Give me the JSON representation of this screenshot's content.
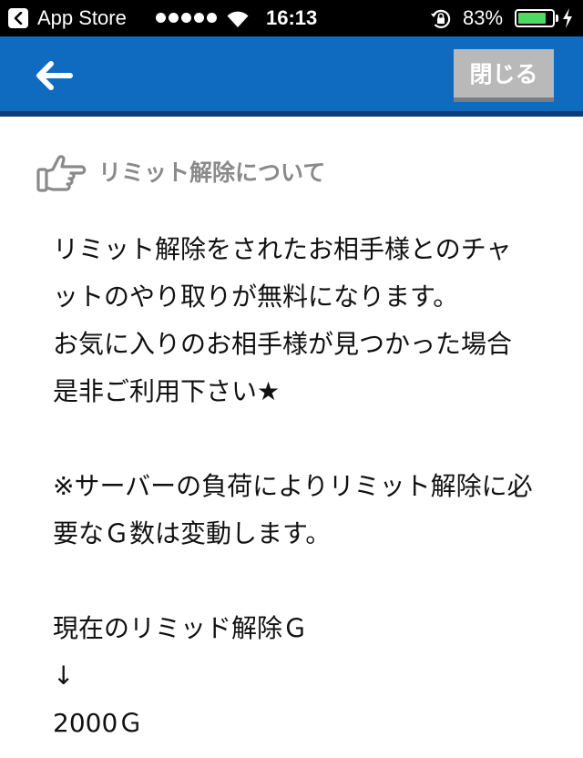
{
  "status_bar": {
    "app_name": "App Store",
    "time": "16:13",
    "battery_percent": "83%",
    "battery_level": 0.83,
    "signal_bars": 5
  },
  "nav": {
    "back_icon": "arrow-left-icon",
    "close_label": "閉じる",
    "bar_color": "#0e6bbf"
  },
  "section": {
    "icon": "thumbs-up-pointing-icon",
    "title": "リミット解除について"
  },
  "body": {
    "paragraph1": "リミット解除をされたお相手様とのチャットのやり取りが無料になります。",
    "paragraph2": "お気に入りのお相手様が見つかった場合是非ご利用下さい★",
    "paragraph3": "※サーバーの負荷によりリミット解除に必要なＧ数は変動します。",
    "current_label": "現在のリミッド解除Ｇ",
    "arrow": "↓",
    "amount": "2000Ｇ"
  }
}
